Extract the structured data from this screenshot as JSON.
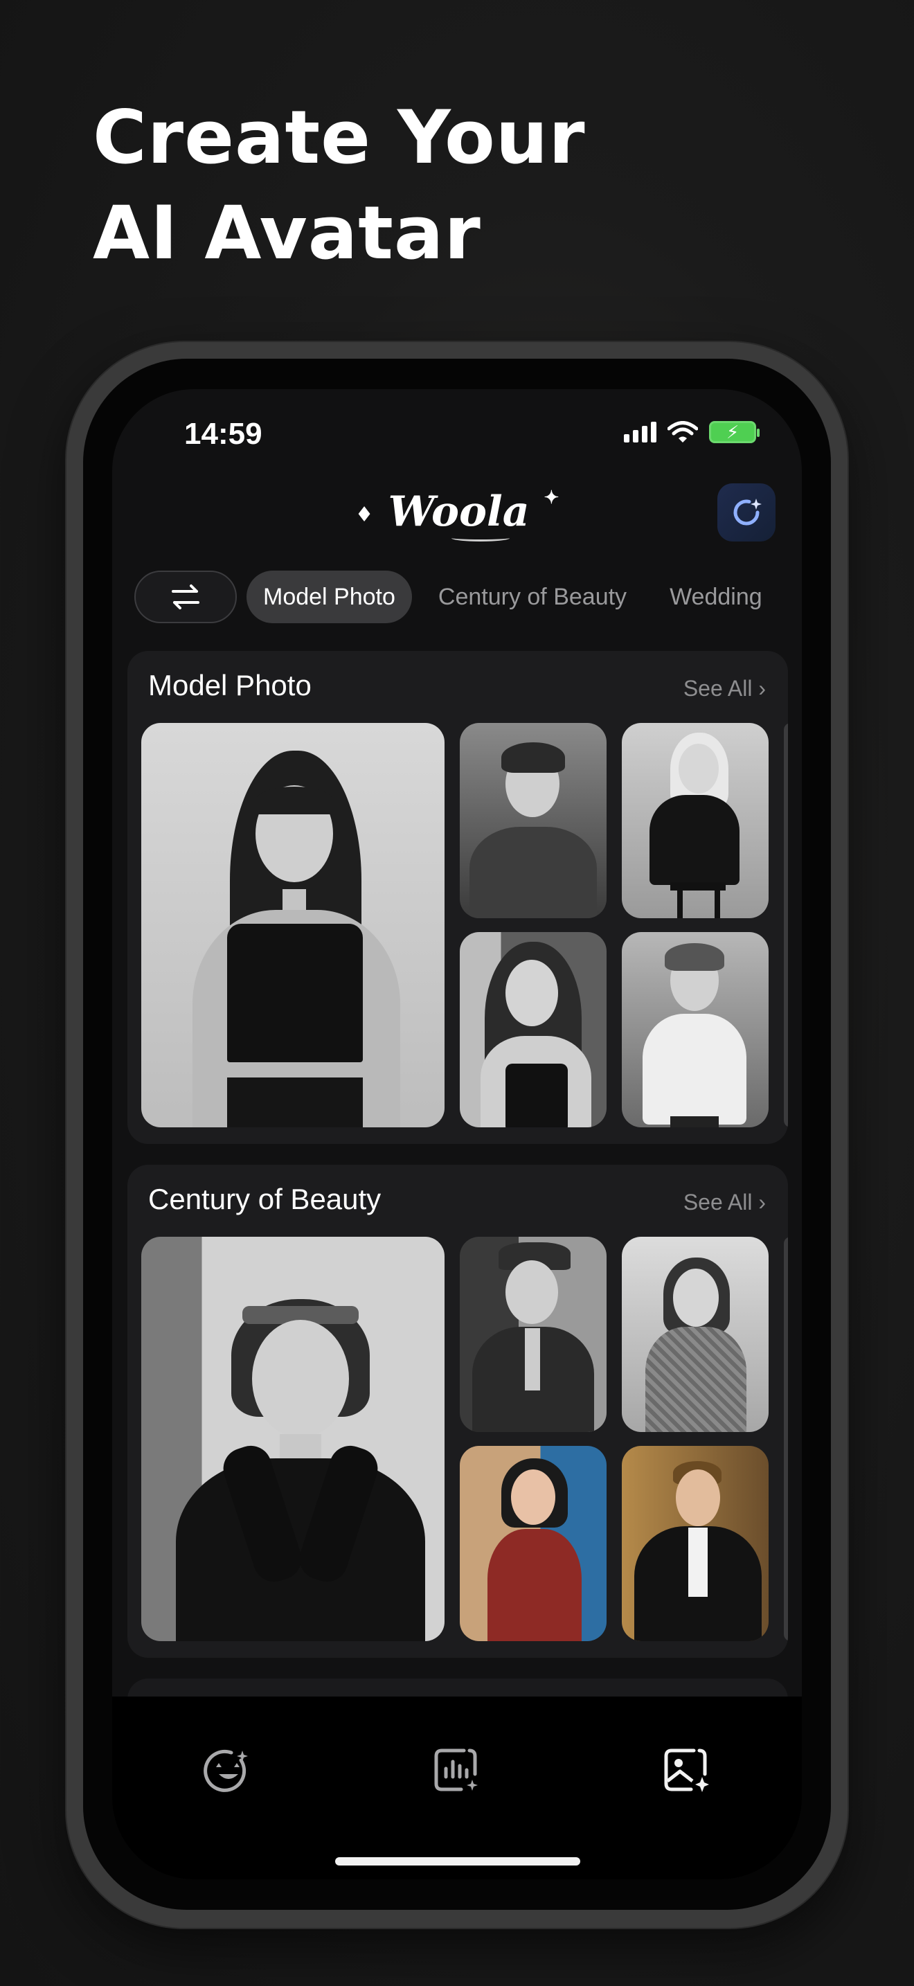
{
  "headline": {
    "line1": "Create Your",
    "line2": "AI  Avatar"
  },
  "status_bar": {
    "time": "14:59",
    "battery_bolt": "⚡"
  },
  "header": {
    "logo_text": "Woola",
    "logo_spark_left": "♦",
    "logo_spark_right": "✦"
  },
  "tabs": [
    {
      "label": "Model Photo",
      "active": true
    },
    {
      "label": "Century of Beauty",
      "active": false
    },
    {
      "label": "Wedding",
      "active": false
    }
  ],
  "sections": [
    {
      "title": "Model Photo",
      "see_all": "See All ›"
    },
    {
      "title": "Century of Beauty",
      "see_all": "See All ›"
    }
  ],
  "tabbar": {
    "items": [
      {
        "icon": "avatar-face-sparkle-icon"
      },
      {
        "icon": "chart-sparkle-icon"
      },
      {
        "icon": "image-sparkle-icon"
      }
    ]
  },
  "colors": {
    "background": "#141414",
    "screen": "#111112",
    "card": "#1c1c1e",
    "active_tab": "#3a3a3c",
    "accent_blue": "#7aa2ff",
    "battery_green": "#4fcf52"
  }
}
